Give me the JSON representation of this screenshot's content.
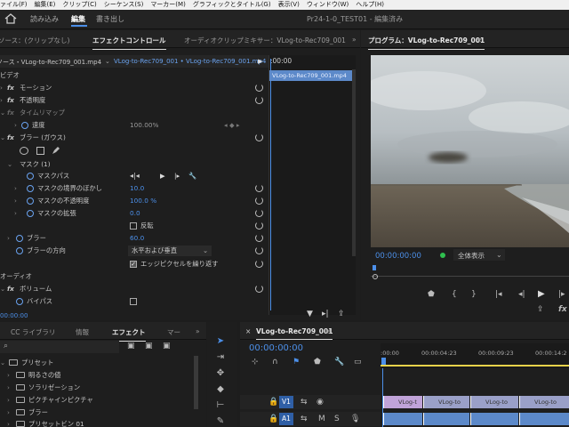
{
  "menu": [
    "ァイル(F)",
    "編集(E)",
    "クリップ(C)",
    "シーケンス(S)",
    "マーカー(M)",
    "グラフィックとタイトル(G)",
    "表示(V)",
    "ウィンドウ(W)",
    "ヘルプ(H)"
  ],
  "workspace": {
    "tabs": [
      "読み込み",
      "編集",
      "書き出し"
    ],
    "active": "編集",
    "title": "Pr24-1-0_TEST01 - 編集済み"
  },
  "left_panel": {
    "tabs": [
      "ソース：(クリップなし)",
      "エフェクトコントロール",
      "オーディオクリップミキサー：VLog-to-Rec709_001"
    ],
    "overflow": "»",
    "source_label": "ソース・VLog-to-Rec709_001.mp4",
    "sequence_label": "VLog-to-Rec709_001 • VLog-to-Rec709_001.mp4",
    "time_start": ":00:00",
    "clip_name": "VLog-to-Rec709_001.mp4",
    "time_bottom": "00:00:00",
    "rows": [
      {
        "label": "ビデオ"
      },
      {
        "fx": "fx",
        "label": "モーション"
      },
      {
        "fx": "fx",
        "label": "不透明度"
      },
      {
        "fx": "fx",
        "label": "タイムリマップ"
      },
      {
        "label": "速度",
        "value": "100.00%"
      },
      {
        "fx": "fx",
        "label": "ブラー (ガウス)"
      },
      {
        "label": "マスク (1)"
      },
      {
        "label": "マスクパス"
      },
      {
        "label": "マスクの境界のぼかし",
        "value": "10.0"
      },
      {
        "label": "マスクの不透明度",
        "value": "100.0 %"
      },
      {
        "label": "マスクの拡張",
        "value": "0.0"
      },
      {
        "label": "",
        "checkbox": "反転"
      },
      {
        "label": "ブラー",
        "value": "60.0"
      },
      {
        "label": "ブラーの方向",
        "select": "水平および垂直"
      },
      {
        "label": "",
        "checkbox": "エッジピクセルを繰り返す",
        "checked": true
      },
      {
        "label": "オーディオ"
      },
      {
        "fx": "fx",
        "label": "ボリューム"
      },
      {
        "label": "バイパス"
      }
    ]
  },
  "program": {
    "title": "プログラム：VLog-to-Rec709_001",
    "menu": "≡",
    "timecode": "00:00:00:00",
    "fit": "全体表示"
  },
  "effects_panel": {
    "tabs": [
      "CC ライブラリ",
      "情報",
      "エフェクト",
      "マー"
    ],
    "overflow": "»",
    "tree": [
      "プリセット",
      "明るさの値",
      "ソラリゼーション",
      "ピクチャインピクチャ",
      "ブラー",
      "プリセットビン 01"
    ]
  },
  "sequence": {
    "name": "VLog-to-Rec709_001",
    "menu": "≡",
    "timecode": "00:00:00:00",
    "ruler": [
      ":00:00",
      "00:00:04:23",
      "00:00:09:23",
      "00:00:14:2"
    ],
    "tracks": [
      {
        "name": "V1"
      },
      {
        "name": "A1"
      }
    ],
    "clips_v": [
      "VLog-t",
      "VLog-to",
      "VLog-to",
      "VLog-to"
    ],
    "clips_a": [
      "",
      "",
      "",
      ""
    ],
    "track_btns": [
      "M",
      "S"
    ]
  },
  "colors": {
    "accent": "#4c8fe8",
    "clip_video": "#9aa0c8",
    "clip_audio": "#5c89c9"
  }
}
